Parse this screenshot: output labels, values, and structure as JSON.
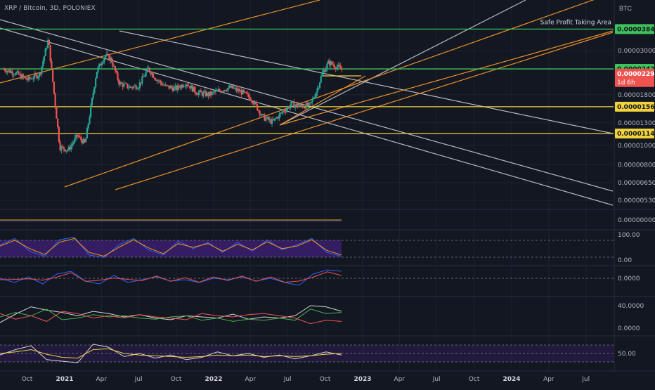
{
  "header": {
    "symbol_title": "XRP / Bitcoin, 3D, POLONIEX",
    "currency": "BTC"
  },
  "colors": {
    "background": "#131722",
    "up": "#26a69a",
    "down": "#ef5350",
    "support_yellow": "#f0d23c",
    "resistance_green": "#3ec35a",
    "trend_orange": "#e8902a",
    "trend_white": "#d1d4dc",
    "rsi_band": "#3b1f6e"
  },
  "chart_data": [
    {
      "type": "candlestick",
      "panel": "price",
      "currency": "BTC",
      "scale": "log",
      "y_ticks": [
        "0.00003000",
        "0.00001800",
        "0.00001300",
        "0.00001000",
        "0.00000800",
        "0.00000650",
        "0.00000530"
      ],
      "x_ticks": [
        "Oct",
        "2021",
        "Apr",
        "Jul",
        "Oct",
        "2022",
        "Apr",
        "Jul",
        "Oct",
        "2023",
        "Apr",
        "Jul",
        "Oct",
        "2024",
        "Apr",
        "Jul"
      ],
      "x_bold_ticks": [
        "2021",
        "2022",
        "2023",
        "2024"
      ],
      "series": [
        {
          "name": "XRP/BTC close (approx.)",
          "x": [
            "2020-08-05",
            "2020-09-01",
            "2020-10-01",
            "2020-11-01",
            "2020-11-22",
            "2020-12-20",
            "2021-01-10",
            "2021-02-01",
            "2021-02-20",
            "2021-03-20",
            "2021-04-10",
            "2021-04-25",
            "2021-05-15",
            "2021-06-10",
            "2021-07-01",
            "2021-07-25",
            "2021-08-15",
            "2021-09-05",
            "2021-10-01",
            "2021-10-25",
            "2021-11-20",
            "2021-12-20",
            "2022-01-15",
            "2022-02-10",
            "2022-03-10",
            "2022-04-05",
            "2022-05-01",
            "2022-05-25",
            "2022-06-15",
            "2022-07-10",
            "2022-08-01",
            "2022-08-25",
            "2022-09-10",
            "2022-09-25",
            "2022-10-10",
            "2022-10-25",
            "2022-11-05",
            "2022-11-12"
          ],
          "values": [
            2.42e-05,
            2.32e-05,
            2.14e-05,
            2.28e-05,
            3.42e-05,
            9.8e-06,
            9.5e-06,
            1.12e-05,
            1.02e-05,
            2.35e-05,
            2.85e-05,
            2.7e-05,
            2.05e-05,
            1.96e-05,
            2e-05,
            2.43e-05,
            2.14e-05,
            1.98e-05,
            1.93e-05,
            2.07e-05,
            1.85e-05,
            1.8e-05,
            1.89e-05,
            1.96e-05,
            1.86e-05,
            1.71e-05,
            1.39e-05,
            1.31e-05,
            1.45e-05,
            1.61e-05,
            1.58e-05,
            1.59e-05,
            1.88e-05,
            2.33e-05,
            2.62e-05,
            2.52e-05,
            2.45e-05,
            2.4e-05
          ]
        }
      ],
      "horizontal_levels": [
        {
          "value": "0.00003848",
          "kind": "resistance",
          "color": "#3ec35a",
          "label": "Safe Profit Taking Area"
        },
        {
          "value": "0.00002427",
          "kind": "resistance",
          "color": "#3ec35a"
        },
        {
          "value": "0.00001566",
          "kind": "support",
          "color": "#f0d23c"
        },
        {
          "value": "0.00001148",
          "kind": "support",
          "color": "#f0d23c"
        }
      ],
      "last_price": {
        "value": "0.00002297",
        "countdown": "1d 6h",
        "color": "#ef5350"
      }
    },
    {
      "type": "line",
      "panel": "volume",
      "y_ticks": [
        "0.00000000"
      ]
    },
    {
      "type": "line",
      "panel": "stoch_rsi",
      "y_ticks": [
        "100.00",
        "0.00"
      ],
      "series": [
        {
          "name": "",
          "color": "#2962ff",
          "values": [
            60,
            85,
            35,
            15,
            80,
            90,
            20,
            10,
            60,
            85,
            40,
            20,
            75,
            45,
            70,
            30,
            70,
            35,
            80,
            40,
            60,
            85,
            30,
            15
          ]
        },
        {
          "name": "",
          "color": "#ff9800",
          "values": [
            55,
            78,
            45,
            22,
            70,
            85,
            30,
            15,
            50,
            80,
            48,
            25,
            65,
            50,
            65,
            35,
            62,
            40,
            72,
            45,
            55,
            80,
            38,
            20
          ]
        }
      ]
    },
    {
      "type": "line",
      "panel": "macd",
      "y_ticks": [
        "0.0000"
      ]
    },
    {
      "type": "line",
      "panel": "dmi",
      "y_ticks": [
        "40.0000",
        "0.0000"
      ]
    },
    {
      "type": "line",
      "panel": "rsi",
      "y_ticks": [
        "50.00"
      ]
    }
  ]
}
